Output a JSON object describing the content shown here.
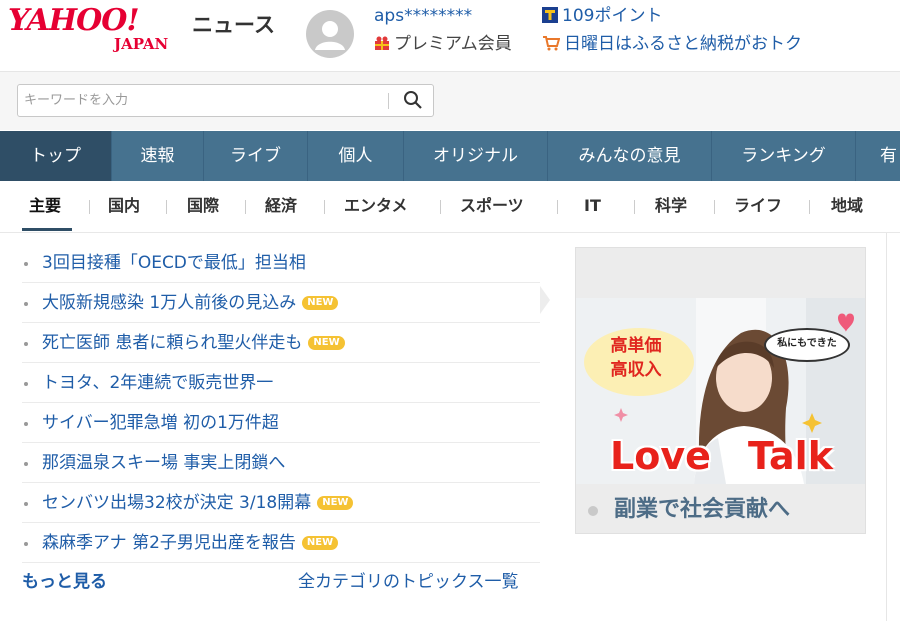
{
  "header": {
    "logo_text": "YAHOO!",
    "logo_sub": "JAPAN",
    "service_name": "ニュース",
    "user_name": "aps********",
    "premium_label": "プレミアム会員",
    "points_label": "109ポイント",
    "promo_label": "日曜日はふるさと納税がおトク",
    "icons": [
      "avatar-icon",
      "gift-icon",
      "t-point-icon",
      "cart-icon"
    ]
  },
  "search": {
    "placeholder": "キーワードを入力",
    "value": ""
  },
  "main_nav": {
    "tabs": [
      {
        "label": "トップ",
        "active": true
      },
      {
        "label": "速報",
        "active": false
      },
      {
        "label": "ライブ",
        "active": false
      },
      {
        "label": "個人",
        "active": false
      },
      {
        "label": "オリジナル",
        "active": false
      },
      {
        "label": "みんなの意見",
        "active": false
      },
      {
        "label": "ランキング",
        "active": false
      },
      {
        "label": "有",
        "active": false
      }
    ]
  },
  "sub_nav": {
    "items": [
      {
        "label": "主要",
        "active": true
      },
      {
        "label": "国内",
        "active": false
      },
      {
        "label": "国際",
        "active": false
      },
      {
        "label": "経済",
        "active": false
      },
      {
        "label": "エンタメ",
        "active": false
      },
      {
        "label": "スポーツ",
        "active": false
      },
      {
        "label": "IT",
        "active": false
      },
      {
        "label": "科学",
        "active": false
      },
      {
        "label": "ライフ",
        "active": false
      },
      {
        "label": "地域",
        "active": false
      }
    ]
  },
  "topics": {
    "items": [
      {
        "title": "3回目接種「OECDで最低」担当相",
        "new": ""
      },
      {
        "title": "大阪新規感染 1万人前後の見込み",
        "new": "NEW"
      },
      {
        "title": "死亡医師 患者に頼られ聖火伴走も",
        "new": "NEW"
      },
      {
        "title": "トヨタ、2年連続で販売世界一",
        "new": ""
      },
      {
        "title": "サイバー犯罪急増 初の1万件超",
        "new": ""
      },
      {
        "title": "那須温泉スキー場 事実上閉鎖へ",
        "new": ""
      },
      {
        "title": "センバツ出場32校が決定 3/18開幕",
        "new": "NEW"
      },
      {
        "title": "森麻季アナ 第2子男児出産を報告",
        "new": "NEW"
      }
    ],
    "more_label": "もっと見る",
    "all_categories_label": "全カテゴリのトピックス一覧"
  },
  "ad": {
    "bubble_left": "高単価\n高収入",
    "bubble_left_line1": "高単価",
    "bubble_left_line2": "高収入",
    "bubble_right": "私にもできた",
    "headline_word1": "Love",
    "headline_word2": "Talk",
    "caption": "副業で社会貢献へ"
  },
  "colors": {
    "brand_red": "#e60033",
    "link_blue": "#1f5da8",
    "nav_bg": "#46728f",
    "nav_active": "#2f4e66",
    "new_badge": "#f5c233"
  }
}
